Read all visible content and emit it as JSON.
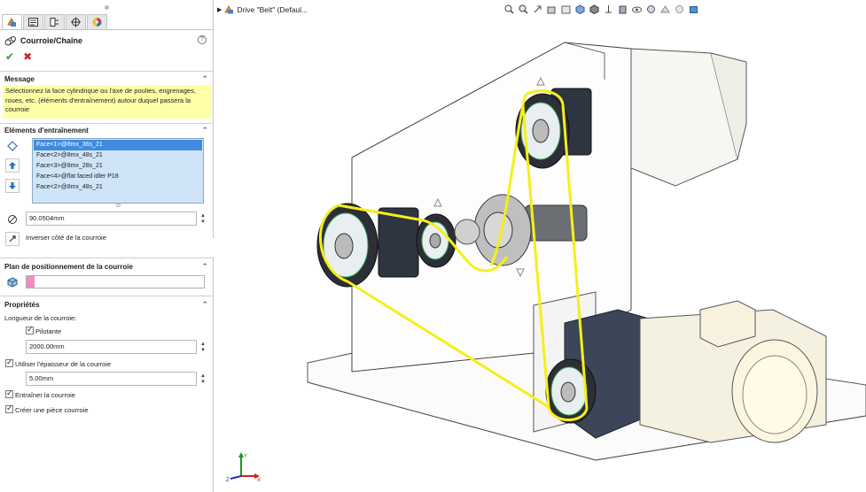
{
  "feature": {
    "title": "Courroie/Chaîne",
    "ok_symbol": "✔",
    "cancel_symbol": "✖",
    "help_symbol": "?"
  },
  "tabs": [
    {
      "name": "feature-manager",
      "active": true
    },
    {
      "name": "property-manager",
      "active": false
    },
    {
      "name": "configuration-manager",
      "active": false
    },
    {
      "name": "dimxpert-manager",
      "active": false
    },
    {
      "name": "display-manager",
      "active": false
    }
  ],
  "message": {
    "header": "Message",
    "text": "Sélectionnez la face cylindrique ou l'axe de poulies, engrenages, roues, etc. (éléments d'entraînement) autour duquel passera la courroie"
  },
  "drive_elements": {
    "header": "Eléments d'entraînement",
    "items": [
      "Face<1>@8mx_36s_21",
      "Face<2>@8mx_48s_21",
      "Face<3>@8mx_28s_21",
      "Face<4>@flat faced idler P18",
      "Face<2>@8mx_48s_21"
    ],
    "selected_index": 0,
    "pitch_value": "90.0504mm",
    "flip_label": "Inverser côté de la courroie"
  },
  "plane": {
    "header": "Plan de positionnement de la courroie",
    "swatch_color": "#f08ec0"
  },
  "properties": {
    "header": "Propriétés",
    "length_label": "Longueur de la courroie:",
    "driving_label": "Pilotante",
    "driving_checked": true,
    "length_value": "2000.00mm",
    "thickness_label": "Utiliser l'épaisseur de la courroie",
    "thickness_checked": true,
    "thickness_value": "5.00mm",
    "engage_label": "Entraîner la courroie",
    "engage_checked": true,
    "create_part_label": "Créer une pièce courroie",
    "create_part_checked": true
  },
  "viewport": {
    "tree_label": "Drive \"Belt\"  (Defaul...",
    "toolbar_icons": [
      "zoom-to-fit-icon",
      "zoom-area-icon",
      "previous-view-icon",
      "section-view-icon",
      "dynamic-annotation-icon",
      "view-orientation-icon",
      "display-style-icon",
      "hide-show-icon",
      "edit-appearance-icon",
      "apply-scene-icon",
      "view-settings-icon",
      "shadows-icon",
      "realview-icon",
      "screen-capture-icon"
    ],
    "belt_color": "#f5ef1a",
    "axis_labels": {
      "y": "Y",
      "x": "X",
      "z": "Z"
    }
  }
}
